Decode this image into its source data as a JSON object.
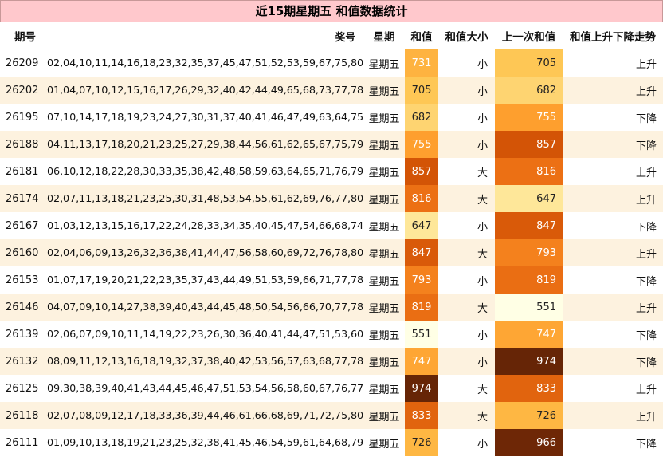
{
  "title": "近15期星期五 和值数据统计",
  "headers": {
    "id": "期号",
    "numbers": "奖号",
    "weekday": "星期",
    "sum": "和值",
    "size": "和值大小",
    "prev_sum": "上一次和值",
    "trend": "和值上升下降走势"
  },
  "rows": [
    {
      "id": "26209",
      "numbers": "02,04,10,11,14,16,18,23,32,35,37,45,47,51,52,53,59,67,75,80",
      "weekday": "星期五",
      "sum": "731",
      "size": "小",
      "prev_sum": "705",
      "trend": "上升"
    },
    {
      "id": "26202",
      "numbers": "01,04,07,10,12,15,16,17,26,29,32,40,42,44,49,65,68,73,77,78",
      "weekday": "星期五",
      "sum": "705",
      "size": "小",
      "prev_sum": "682",
      "trend": "上升"
    },
    {
      "id": "26195",
      "numbers": "07,10,14,17,18,19,23,24,27,30,31,37,40,41,46,47,49,63,64,75",
      "weekday": "星期五",
      "sum": "682",
      "size": "小",
      "prev_sum": "755",
      "trend": "下降"
    },
    {
      "id": "26188",
      "numbers": "04,11,13,17,18,20,21,23,25,27,29,38,44,56,61,62,65,67,75,79",
      "weekday": "星期五",
      "sum": "755",
      "size": "小",
      "prev_sum": "857",
      "trend": "下降"
    },
    {
      "id": "26181",
      "numbers": "06,10,12,18,22,28,30,33,35,38,42,48,58,59,63,64,65,71,76,79",
      "weekday": "星期五",
      "sum": "857",
      "size": "大",
      "prev_sum": "816",
      "trend": "上升"
    },
    {
      "id": "26174",
      "numbers": "02,07,11,13,18,21,23,25,30,31,48,53,54,55,61,62,69,76,77,80",
      "weekday": "星期五",
      "sum": "816",
      "size": "大",
      "prev_sum": "647",
      "trend": "上升"
    },
    {
      "id": "26167",
      "numbers": "01,03,12,13,15,16,17,22,24,28,33,34,35,40,45,47,54,66,68,74",
      "weekday": "星期五",
      "sum": "647",
      "size": "小",
      "prev_sum": "847",
      "trend": "下降"
    },
    {
      "id": "26160",
      "numbers": "02,04,06,09,13,26,32,36,38,41,44,47,56,58,60,69,72,76,78,80",
      "weekday": "星期五",
      "sum": "847",
      "size": "大",
      "prev_sum": "793",
      "trend": "上升"
    },
    {
      "id": "26153",
      "numbers": "01,07,17,19,20,21,22,23,35,37,43,44,49,51,53,59,66,71,77,78",
      "weekday": "星期五",
      "sum": "793",
      "size": "小",
      "prev_sum": "819",
      "trend": "下降"
    },
    {
      "id": "26146",
      "numbers": "04,07,09,10,14,27,38,39,40,43,44,45,48,50,54,56,66,70,77,78",
      "weekday": "星期五",
      "sum": "819",
      "size": "大",
      "prev_sum": "551",
      "trend": "上升"
    },
    {
      "id": "26139",
      "numbers": "02,06,07,09,10,11,14,19,22,23,26,30,36,40,41,44,47,51,53,60",
      "weekday": "星期五",
      "sum": "551",
      "size": "小",
      "prev_sum": "747",
      "trend": "下降"
    },
    {
      "id": "26132",
      "numbers": "08,09,11,12,13,16,18,19,32,37,38,40,42,53,56,57,63,68,77,78",
      "weekday": "星期五",
      "sum": "747",
      "size": "小",
      "prev_sum": "974",
      "trend": "下降"
    },
    {
      "id": "26125",
      "numbers": "09,30,38,39,40,41,43,44,45,46,47,51,53,54,56,58,60,67,76,77",
      "weekday": "星期五",
      "sum": "974",
      "size": "大",
      "prev_sum": "833",
      "trend": "上升"
    },
    {
      "id": "26118",
      "numbers": "02,07,08,09,12,17,18,33,36,39,44,46,61,66,68,69,71,72,75,80",
      "weekday": "星期五",
      "sum": "833",
      "size": "大",
      "prev_sum": "726",
      "trend": "上升"
    },
    {
      "id": "26111",
      "numbers": "01,09,10,13,18,19,21,23,25,32,38,41,45,46,54,59,61,64,68,79",
      "weekday": "星期五",
      "sum": "726",
      "size": "小",
      "prev_sum": "966",
      "trend": "下降"
    }
  ],
  "colors": {
    "title_background": "#ffc8cc",
    "row_alt_background": "#fdf2df",
    "heat_low": "#ffffe5",
    "heat_high": "#662506"
  }
}
